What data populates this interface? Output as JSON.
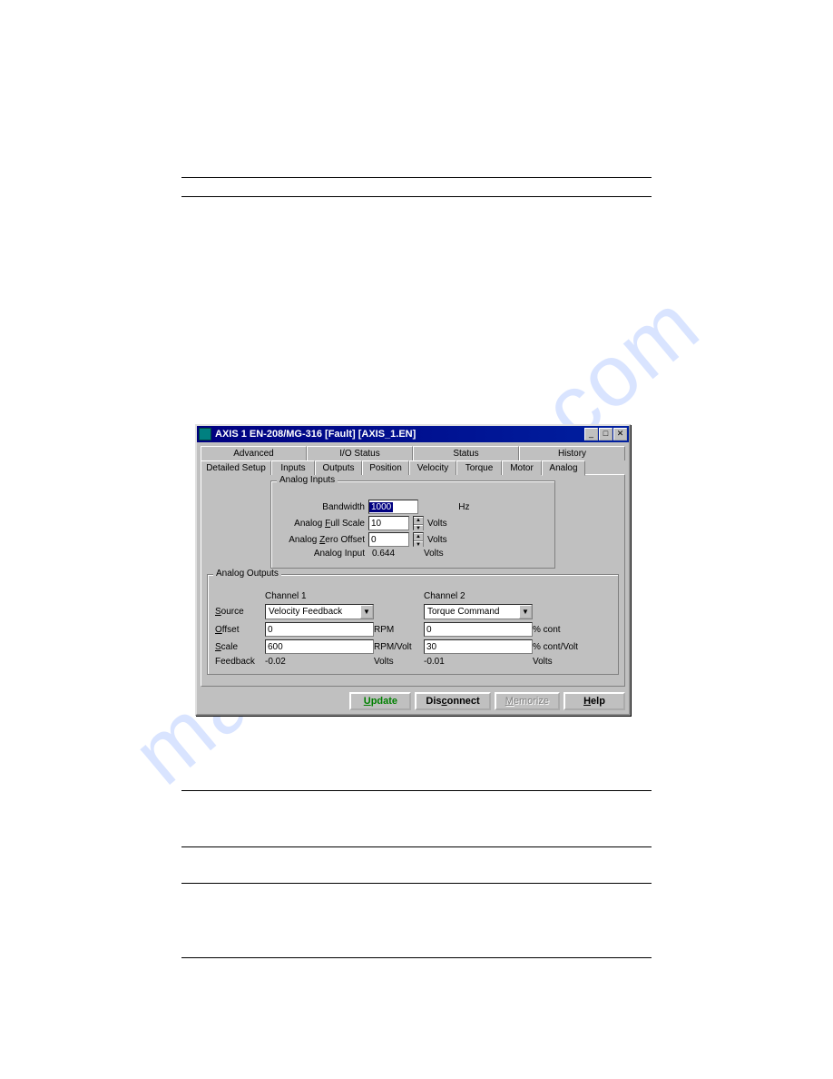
{
  "watermark": "manualshive.com",
  "window": {
    "title": "AXIS 1   EN-208/MG-316   [Fault]   [AXIS_1.EN]"
  },
  "tabs_top": [
    "Advanced",
    "I/O Status",
    "Status",
    "History"
  ],
  "tabs_bottom": [
    "Detailed Setup",
    "Inputs",
    "Outputs",
    "Position",
    "Velocity",
    "Torque",
    "Motor",
    "Analog"
  ],
  "analog_inputs": {
    "group": "Analog Inputs",
    "bandwidth_label": "Bandwidth",
    "bandwidth_value": "1000",
    "bandwidth_unit": "Hz",
    "fullscale_label_pre": "Analog ",
    "fullscale_label_u": "F",
    "fullscale_label_post": "ull Scale",
    "fullscale_value": "10",
    "fullscale_unit": "Volts",
    "zero_label_pre": "Analog ",
    "zero_label_u": "Z",
    "zero_label_post": "ero Offset",
    "zero_value": "0",
    "zero_unit": "Volts",
    "input_label": "Analog Input",
    "input_value": "0.644",
    "input_unit": "Volts"
  },
  "analog_outputs": {
    "group": "Analog Outputs",
    "ch1": "Channel 1",
    "ch2": "Channel 2",
    "source_label_u": "S",
    "source_label_post": "ource",
    "source1": "Velocity Feedback",
    "source2": "Torque Command",
    "offset_label_u": "O",
    "offset_label_post": "ffset",
    "offset1": "0",
    "offset1_unit": "RPM",
    "offset2": "0",
    "offset2_unit": "% cont",
    "scale_label_u": "S",
    "scale_label_post": "cale",
    "scale1": "600",
    "scale1_unit": "RPM/Volt",
    "scale2": "30",
    "scale2_unit": "% cont/Volt",
    "feedback_label": "Feedback",
    "fb1": "-0.02",
    "fb1_unit": "Volts",
    "fb2": "-0.01",
    "fb2_unit": "Volts"
  },
  "buttons": {
    "update_u": "U",
    "update_rest": "pdate",
    "disconnect_u": "c",
    "disconnect_pre": "Dis",
    "disconnect_post": "onnect",
    "memorize_u": "M",
    "memorize_rest": "emorize",
    "help_u": "H",
    "help_rest": "elp"
  }
}
